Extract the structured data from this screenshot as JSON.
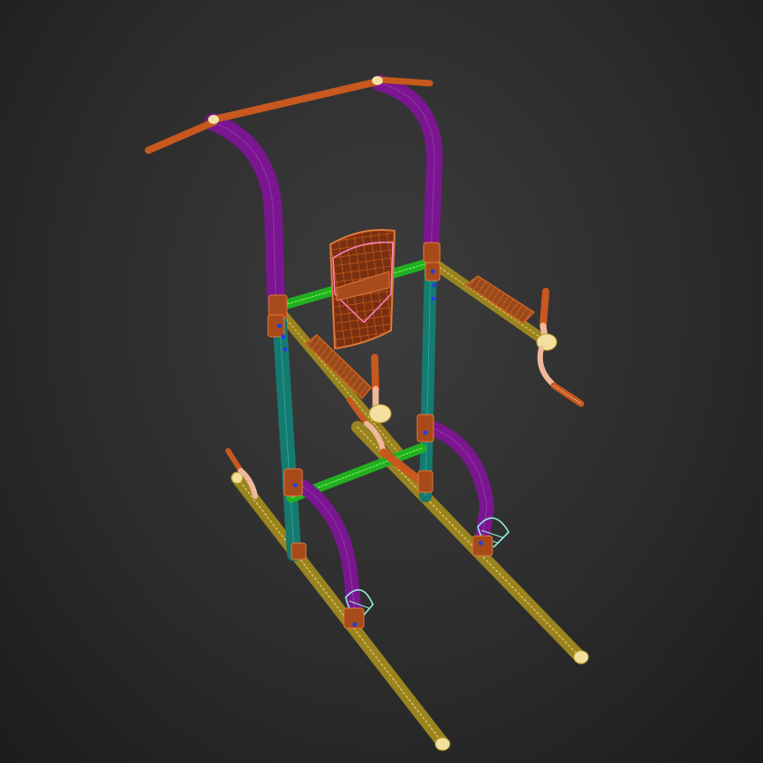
{
  "viewport": {
    "icon": "wireframe-power-tower-icon",
    "colors": {
      "purple": "#8a1a9e",
      "purple_wire": "#b040c8",
      "orange": "#c8581e",
      "orange_wire": "#e07a3a",
      "green": "#2ecc2e",
      "green_wire": "#7aff5a",
      "teal": "#1a8a80",
      "teal_wire": "#2fc0b0",
      "yellow": "#b8a028",
      "yellow_wire": "#e6d060",
      "peach": "#f0b89a",
      "cyan": "#8ff0e0",
      "pink": "#ff80c0",
      "cap": "#f3e0a0",
      "blue_bolt": "#2040e0"
    }
  }
}
